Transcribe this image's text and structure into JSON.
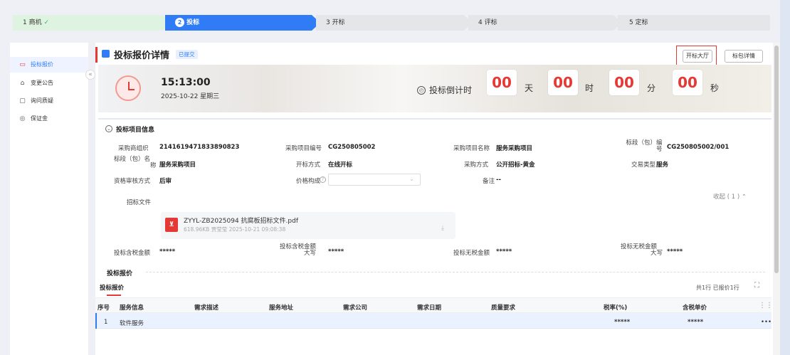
{
  "steps": [
    {
      "num": "1",
      "label": "商机",
      "state": "done"
    },
    {
      "num": "2",
      "label": "投标",
      "state": "active"
    },
    {
      "num": "3",
      "label": "开标",
      "state": "todo"
    },
    {
      "num": "4",
      "label": "评标",
      "state": "todo"
    },
    {
      "num": "5",
      "label": "定标",
      "state": "todo"
    }
  ],
  "sidebar": {
    "items": [
      {
        "label": "投标报价",
        "icon": "quote-icon",
        "active": true
      },
      {
        "label": "变更公告",
        "icon": "notice-icon",
        "active": false
      },
      {
        "label": "询问质疑",
        "icon": "question-doc-icon",
        "active": false
      },
      {
        "label": "保证金",
        "icon": "shield-icon",
        "active": false
      }
    ],
    "collapse": "«"
  },
  "header": {
    "title": "投标报价详情",
    "status": "已提交",
    "btn_hall": "开标大厅",
    "btn_package": "标包详情"
  },
  "banner": {
    "time": "15:13:00",
    "date": "2025-10-22 星期三",
    "countdown_label": "投标倒计时",
    "days": "00",
    "day_unit": "天",
    "hours": "00",
    "hour_unit": "时",
    "minutes": "00",
    "minute_unit": "分",
    "seconds": "00",
    "second_unit": "秒"
  },
  "project": {
    "section_title": "投标项目信息",
    "org_label": "采购商组织",
    "org_value": "2141619471833890823",
    "code_label": "采购项目编号",
    "code_value": "CG250805002",
    "name_label": "采购项目名称",
    "name_value": "服务采购项目",
    "pkg_no_label_a": "标段（包）编",
    "pkg_no_label_b": "号",
    "pkg_no_value": "CG250805002/001",
    "pkg_name_label_a": "标段（包）名",
    "pkg_name_label_b": "称",
    "pkg_name_value": "服务采购项目",
    "open_method_label": "开标方式",
    "open_method_value": "在线开标",
    "proc_method_label": "采购方式",
    "proc_method_value": "公开招标-黄金",
    "trade_type_label": "交易类型",
    "trade_type_value": "服务",
    "review_label": "资格审核方式",
    "review_value": "后审",
    "price_label": "价格构成",
    "remark_label": "备注",
    "remark_value": "--",
    "doc_label": "招标文件",
    "collapse_text": "收起 ( 1 )",
    "file_name": "ZYYL-ZB2025094 抗腐板招标文件.pdf",
    "file_meta": "618.96KB  贾莹莹  2025-10-21 09:08:38",
    "tax_incl_label": "投标含税金额",
    "tax_incl_value": "*****",
    "tax_incl_upper_label_a": "投标含税金额",
    "tax_incl_upper_label_b": "大写",
    "tax_incl_upper_value": "*****",
    "tax_excl_label": "投标无税金额",
    "tax_excl_value": "*****",
    "tax_excl_upper_label_a": "投标无税金额",
    "tax_excl_upper_label_b": "大写",
    "tax_excl_upper_value": "*****"
  },
  "quote": {
    "section_title": "投标报价",
    "sub_title": "投标报价",
    "summary": "共1行 已报价1行",
    "columns": [
      "序号",
      "服务信息",
      "需求描述",
      "服务地址",
      "需求公司",
      "需求日期",
      "质量要求",
      "税率(%)",
      "含税单价"
    ],
    "row": {
      "index": "1",
      "service": "软件服务",
      "tax_rate": "*****",
      "unit_price": "*****",
      "more": "•••"
    }
  }
}
